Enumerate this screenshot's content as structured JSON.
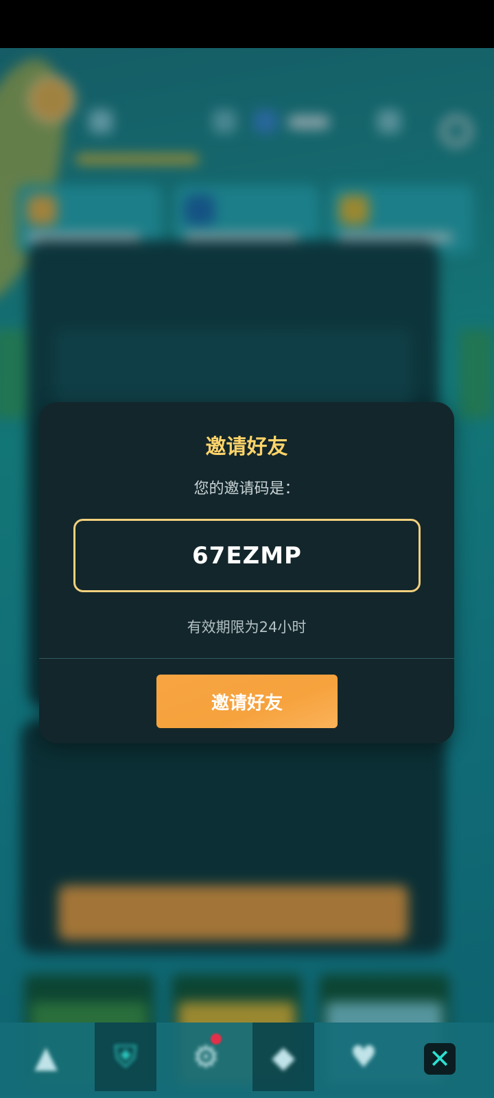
{
  "dialog": {
    "title": "邀请好友",
    "code_label": "您的邀请码是：",
    "invite_code": "67EZMP",
    "expiry_note": "有效期限为24小时",
    "invite_button_label": "邀请好友"
  },
  "colors": {
    "dialog_bg": "#13262b",
    "title": "#ffd46a",
    "code_border": "#f2d07e",
    "button": "#f7a542",
    "close_icon": "#2be0d2"
  },
  "bottom_nav": {
    "icons": [
      "triangle-icon",
      "shield-icon",
      "gear-icon",
      "diamond-icon",
      "heart-icon"
    ],
    "close_icon": "close-icon"
  }
}
